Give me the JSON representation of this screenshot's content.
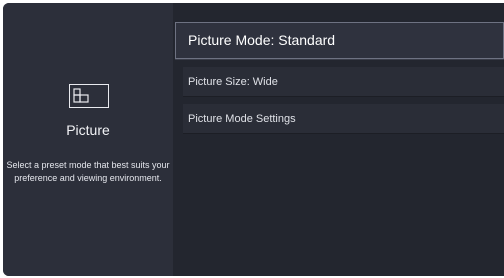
{
  "category": {
    "icon": "picture-icon",
    "title": "Picture",
    "description": "Select a preset mode that best suits your preference and viewing environment."
  },
  "menu": {
    "focused_item": "Picture Mode: Standard",
    "items": [
      {
        "label": "Picture Size: Wide"
      },
      {
        "label": "Picture Mode Settings"
      }
    ]
  },
  "colors": {
    "panel_background": "#2a2d38",
    "focused_border": "#6e7282",
    "text": "#ffffff"
  }
}
